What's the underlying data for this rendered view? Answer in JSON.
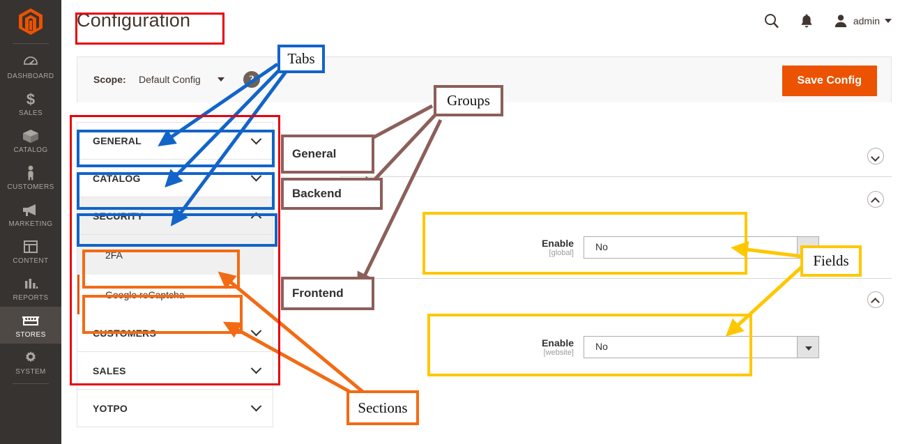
{
  "app": {
    "logo_icon": "magento-logo-icon"
  },
  "sidebar": {
    "items": [
      {
        "label": "DASHBOARD",
        "icon": "dashboard-icon",
        "active": false
      },
      {
        "label": "SALES",
        "icon": "dollar-icon",
        "active": false
      },
      {
        "label": "CATALOG",
        "icon": "box-icon",
        "active": false
      },
      {
        "label": "CUSTOMERS",
        "icon": "person-icon",
        "active": false
      },
      {
        "label": "MARKETING",
        "icon": "megaphone-icon",
        "active": false
      },
      {
        "label": "CONTENT",
        "icon": "layout-icon",
        "active": false
      },
      {
        "label": "REPORTS",
        "icon": "bar-chart-icon",
        "active": false
      },
      {
        "label": "STORES",
        "icon": "store-icon",
        "active": true
      },
      {
        "label": "SYSTEM",
        "icon": "gear-icon",
        "active": false
      }
    ]
  },
  "header": {
    "title": "Configuration",
    "search_icon": "search-icon",
    "notifications_icon": "bell-icon",
    "avatar_icon": "user-avatar-icon",
    "admin_name": "admin",
    "admin_caret_icon": "chevron-down-icon"
  },
  "scope_bar": {
    "label": "Scope:",
    "value": "Default Config",
    "caret_icon": "chevron-down-icon",
    "help_icon": "question-mark-icon",
    "help_glyph": "?",
    "save_label": "Save Config"
  },
  "config_tabs": [
    {
      "label": "GENERAL",
      "state": "collapsed",
      "chevron": "chevron-down-icon"
    },
    {
      "label": "CATALOG",
      "state": "collapsed",
      "chevron": "chevron-down-icon"
    },
    {
      "label": "SECURITY",
      "state": "expanded",
      "chevron": "chevron-up-icon"
    },
    {
      "label": "CUSTOMERS",
      "state": "collapsed",
      "chevron": "chevron-down-icon"
    },
    {
      "label": "SALES",
      "state": "collapsed",
      "chevron": "chevron-down-icon"
    },
    {
      "label": "YOTPO",
      "state": "collapsed",
      "chevron": "chevron-down-icon"
    }
  ],
  "security_sections": [
    {
      "label": "2FA",
      "active": false
    },
    {
      "label": "Google reCaptcha",
      "active": true
    }
  ],
  "groups": [
    {
      "label": "General",
      "state": "collapsed",
      "toggle_icon": "chevron-down-circle-icon"
    },
    {
      "label": "Backend",
      "state": "expanded",
      "toggle_icon": "chevron-up-circle-icon"
    },
    {
      "label": "Frontend",
      "state": "expanded",
      "toggle_icon": "chevron-up-circle-icon"
    }
  ],
  "fields": [
    {
      "name": "Enable",
      "scope": "[global]",
      "value": "No",
      "arrow_icon": "chevron-down-icon"
    },
    {
      "name": "Enable",
      "scope": "[website]",
      "value": "No",
      "arrow_icon": "chevron-down-icon"
    }
  ],
  "annotations": {
    "tabs_label": "Tabs",
    "groups_label": "Groups",
    "fields_label": "Fields",
    "sections_label": "Sections",
    "colors": {
      "tabs": "#1264c8",
      "groups": "#8c5f5a",
      "fields": "#ffc700",
      "sections": "#f26b14",
      "outer": "#e8000d"
    }
  }
}
